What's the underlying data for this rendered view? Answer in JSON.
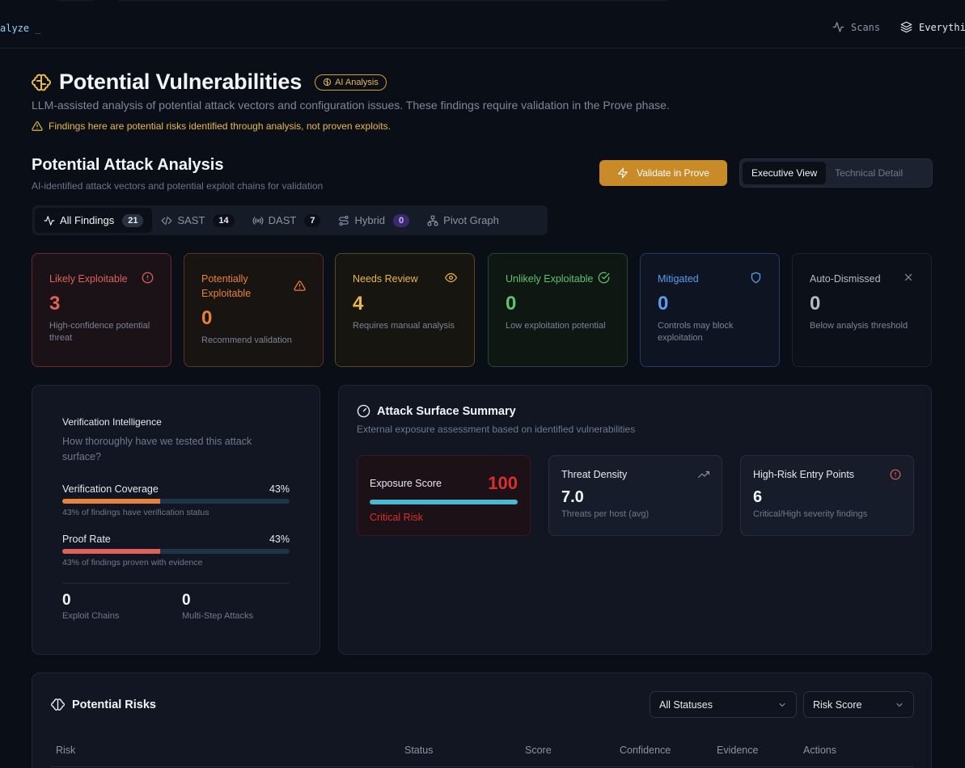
{
  "app": {
    "brand": "alyze",
    "cursor": "_"
  },
  "topnav": {
    "scans": "Scans",
    "everything": "Everythir"
  },
  "header": {
    "title": "Potential Vulnerabilities",
    "badge": "AI Analysis",
    "subtitle": "LLM-assisted analysis of potential attack vectors and configuration issues. These findings require validation in the Prove phase.",
    "warning": "Findings here are potential risks identified through analysis, not proven exploits."
  },
  "section": {
    "title": "Potential Attack Analysis",
    "subtitle": "AI-identified attack vectors and potential exploit chains for validation",
    "validate_label": "Validate in Prove",
    "views": [
      "Executive View",
      "Technical Detail"
    ]
  },
  "tabs": [
    {
      "label": "All Findings",
      "count": "21",
      "icon": "activity-icon"
    },
    {
      "label": "SAST",
      "count": "14",
      "icon": "code-icon"
    },
    {
      "label": "DAST",
      "count": "7",
      "icon": "radio-icon"
    },
    {
      "label": "Hybrid",
      "count": "0",
      "icon": "route-icon"
    },
    {
      "label": "Pivot Graph",
      "icon": "network-icon"
    }
  ],
  "status_cards": [
    {
      "label": "Likely Exploitable",
      "value": "3",
      "desc": "High-confidence potential threat",
      "icon": "alert-circle-icon",
      "color": "#e0605a"
    },
    {
      "label": "Potentially Exploitable",
      "value": "0",
      "desc": "Recommend validation",
      "icon": "alert-triangle-icon",
      "color": "#e8823a"
    },
    {
      "label": "Needs Review",
      "value": "4",
      "desc": "Requires manual analysis",
      "icon": "eye-icon",
      "color": "#e8b84a"
    },
    {
      "label": "Unlikely Exploitable",
      "value": "0",
      "desc": "Low exploitation potential",
      "icon": "check-circle-icon",
      "color": "#5cc46e"
    },
    {
      "label": "Mitigated",
      "value": "0",
      "desc": "Controls may block exploitation",
      "icon": "shield-icon",
      "color": "#5b9bf0"
    },
    {
      "label": "Auto-Dismissed",
      "value": "0",
      "desc": "Below analysis threshold",
      "icon": "x-icon",
      "color": "#b3bac8"
    }
  ],
  "verification": {
    "title": "Verification Intelligence",
    "question": "How thoroughly have we tested this attack surface?",
    "coverage": {
      "label": "Verification Coverage",
      "value": "43%",
      "percent": 43,
      "caption": "43% of findings have verification status",
      "color": "#e8823a"
    },
    "proof": {
      "label": "Proof Rate",
      "value": "43%",
      "percent": 43,
      "caption": "43% of findings proven with evidence",
      "color": "#e0605a"
    },
    "exploit_chains": {
      "value": "0",
      "label": "Exploit Chains"
    },
    "multi_step": {
      "value": "0",
      "label": "Multi-Step Attacks"
    }
  },
  "attack_surface": {
    "title": "Attack Surface Summary",
    "subtitle": "External exposure assessment based on identified vulnerabilities",
    "exposure": {
      "label": "Exposure Score",
      "value": "100",
      "percent": 100,
      "risk": "Critical Risk"
    },
    "density": {
      "label": "Threat Density",
      "value": "7.0",
      "caption": "Threats per host (avg)"
    },
    "entry_points": {
      "label": "High-Risk Entry Points",
      "value": "6",
      "caption": "Critical/High severity findings"
    }
  },
  "risks": {
    "title": "Potential Risks",
    "status_filter": "All Statuses",
    "sort": "Risk Score",
    "columns": [
      "Risk",
      "Status",
      "Score",
      "Confidence",
      "Evidence",
      "Actions"
    ]
  },
  "colors": {
    "accent": "#c98a28",
    "critical": "#d9302c",
    "exposure_bar": "#4cb8d0"
  }
}
